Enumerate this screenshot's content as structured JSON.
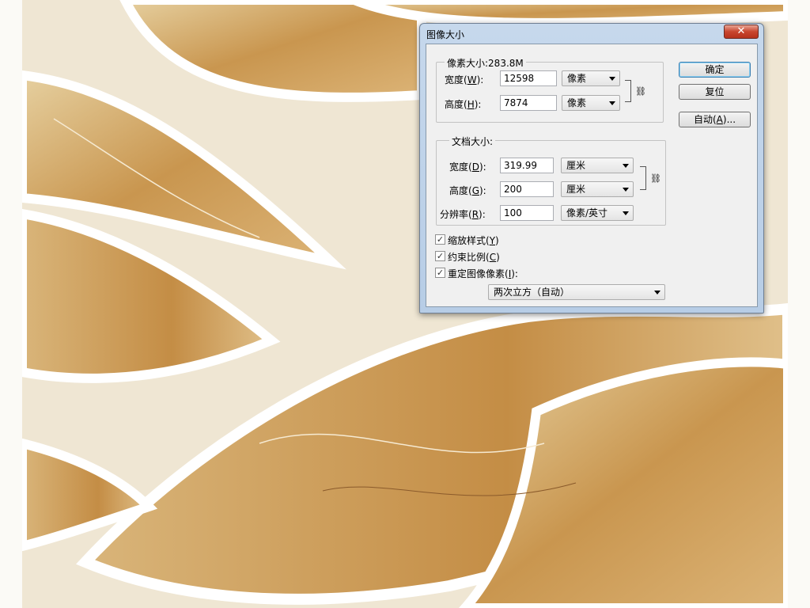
{
  "dialog": {
    "title": "图像大小",
    "close_glyph": "✕",
    "pixel_dimensions": {
      "label": "像素大小:283.8M",
      "width": {
        "label": "宽度(",
        "mnemonic": "W",
        "suffix": "):",
        "value": "12598",
        "unit": "像素"
      },
      "height": {
        "label": "高度(",
        "mnemonic": "H",
        "suffix": "):",
        "value": "7874",
        "unit": "像素"
      }
    },
    "document_size": {
      "label": "文档大小:",
      "width": {
        "label": "宽度(",
        "mnemonic": "D",
        "suffix": "):",
        "value": "319.99",
        "unit": "厘米"
      },
      "height": {
        "label": "高度(",
        "mnemonic": "G",
        "suffix": "):",
        "value": "200",
        "unit": "厘米"
      },
      "resolution": {
        "label": "分辨率(",
        "mnemonic": "R",
        "suffix": "):",
        "value": "100",
        "unit": "像素/英寸"
      }
    },
    "options": {
      "scale_styles": {
        "label": "缩放样式(",
        "mnemonic": "Y",
        "suffix": ")",
        "checked": true
      },
      "constrain_proportions": {
        "label": "约束比例(",
        "mnemonic": "C",
        "suffix": ")",
        "checked": true
      },
      "resample": {
        "label": "重定图像像素(",
        "mnemonic": "I",
        "suffix": "):",
        "checked": true
      }
    },
    "resample_method": "两次立方（自动）",
    "buttons": {
      "ok": "确定",
      "reset": "复位",
      "auto": {
        "label": "自动(",
        "mnemonic": "A",
        "suffix": ")..."
      }
    },
    "check_glyph": "✓",
    "link_glyph": "⛓"
  },
  "colors": {
    "marble_light": "#e8d3a8",
    "marble_dark": "#c89a55",
    "background": "#efe6d2",
    "outline": "#ffffff"
  }
}
